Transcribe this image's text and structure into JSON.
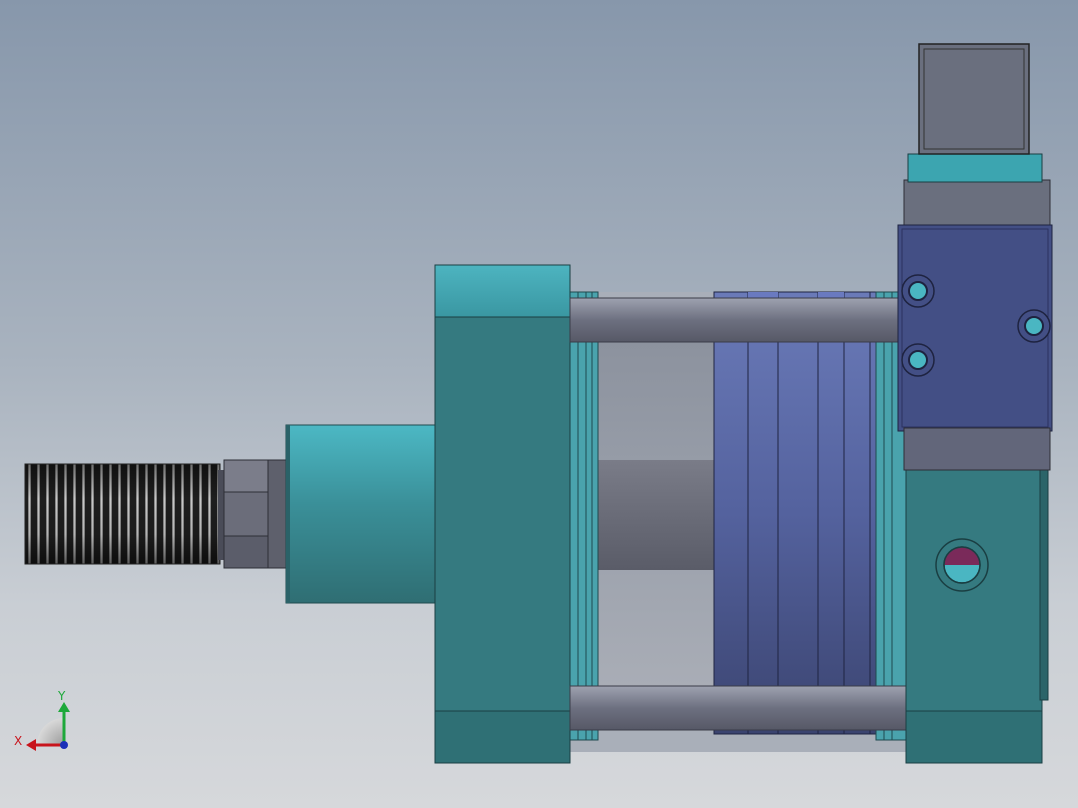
{
  "viewport": {
    "model": "pneumatic-cylinder-with-solenoid-valve",
    "view_orientation": "front"
  },
  "triad": {
    "x_label": "X",
    "y_label": "Y",
    "colors": {
      "x": "#c8141c",
      "y": "#1da83a",
      "z": "#1a2fb8"
    }
  },
  "colors": {
    "background_top": "#8797ab",
    "background_bottom": "#d6d8db",
    "teal_body": "#357a80",
    "teal_highlight": "#4ab6c2",
    "steel_grey": "#6a6f7e",
    "barrel_blue": "#5564a0",
    "valve_blue": "#434f85",
    "port_magenta": "#7a2a5a",
    "thread_dark": "#2a2a2a"
  }
}
